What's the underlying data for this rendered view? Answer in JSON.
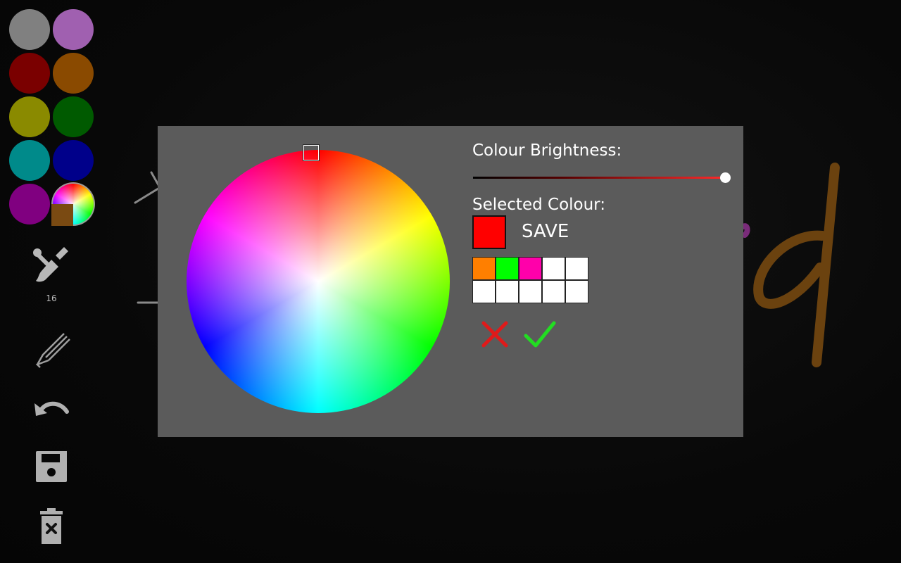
{
  "toolbar": {
    "palette": [
      "#808080",
      "#a060b0",
      "#7a0000",
      "#8a4a00",
      "#8a8a00",
      "#005a00",
      "#008a8a",
      "#00008a",
      "#800080"
    ],
    "current_colour": "#7a4a12",
    "brush_size": "16",
    "icons": [
      "paintbrush-icon",
      "eraser-icon",
      "undo-icon",
      "save-icon",
      "trash-icon"
    ]
  },
  "dialog": {
    "brightness_label": "Colour Brightness:",
    "brightness_value": 1.0,
    "selected_label": "Selected Colour:",
    "selected_colour": "#ff0000",
    "save_label": "SAVE",
    "saved_colours": [
      "#ff7f00",
      "#00ff00",
      "#ff00aa",
      "#ffffff",
      "#ffffff",
      "#ffffff",
      "#ffffff",
      "#ffffff",
      "#ffffff",
      "#ffffff"
    ],
    "cancel_colour": "#e01a1a",
    "ok_colour": "#22dd22"
  }
}
